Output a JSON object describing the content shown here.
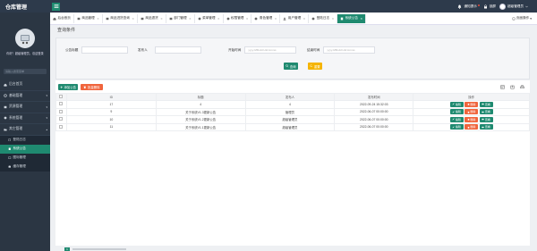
{
  "app": {
    "title": "仓库管理"
  },
  "topbar": {
    "notice_label": "通知提示",
    "lock_label": "锁屏",
    "user_label": "超级管理员"
  },
  "sidebar": {
    "role_text": "你好！超级管理员，欢迎登录",
    "search_placeholder": "请输入搜索菜单",
    "items": [
      {
        "label": "后台首页"
      },
      {
        "label": "基础管理"
      },
      {
        "label": "资源管理"
      },
      {
        "label": "系统管理"
      },
      {
        "label": "其它管理"
      }
    ],
    "sub_items": [
      {
        "label": "登陆日志"
      },
      {
        "label": "系统公告"
      },
      {
        "label": "图标管理"
      },
      {
        "label": "缓存管理"
      }
    ]
  },
  "tabs": [
    {
      "label": "后台首页"
    },
    {
      "label": "商品管理"
    },
    {
      "label": "商品进货查询"
    },
    {
      "label": "商品退货"
    },
    {
      "label": "部门管理"
    },
    {
      "label": "菜单管理"
    },
    {
      "label": "权限管理"
    },
    {
      "label": "角色管理"
    },
    {
      "label": "用户管理"
    },
    {
      "label": "登陆日志"
    },
    {
      "label": "系统公告"
    }
  ],
  "tab_ops_label": "页面操作",
  "query": {
    "title": "查询条件",
    "title_label": "公告标题",
    "operator_label": "发布人",
    "start_label": "开始时间",
    "start_placeholder": "yyyy-MM-dd HH:mm:ss",
    "end_label": "结束时间",
    "end_placeholder": "yyyy-MM-dd HH:mm:ss",
    "search_btn": "查询",
    "reset_btn": "重置"
  },
  "toolbar": {
    "add_btn": "添加公告",
    "batch_delete_btn": "批量删除"
  },
  "table": {
    "headers": [
      "ID",
      "标题",
      "发布人",
      "发布时间",
      "操作"
    ],
    "rows": [
      {
        "id": "17",
        "title": "4",
        "operator": "4",
        "time": "2022-09-24 15:32:03"
      },
      {
        "id": "9",
        "title": "关于系统V1.3更新公告",
        "operator": "管理员",
        "time": "2022-06-07 00:00:00"
      },
      {
        "id": "10",
        "title": "关于系统V1.2更新公告",
        "operator": "超级管理员",
        "time": "2022-06-07 00:00:00"
      },
      {
        "id": "11",
        "title": "关于系统V1.1更新公告",
        "operator": "超级管理员",
        "time": "2022-06-07 00:00:00"
      }
    ],
    "op_edit": "编辑",
    "op_delete": "删除",
    "op_view": "查看"
  },
  "pager": {
    "current": "1"
  },
  "colors": {
    "accent": "#1f8a70",
    "warning": "#f5b400",
    "danger": "#f0643c",
    "sidebar": "#2b3643"
  }
}
